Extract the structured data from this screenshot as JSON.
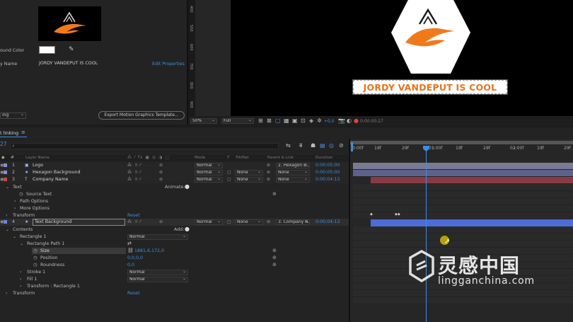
{
  "essential_graphics": {
    "background_color_label": "ound Color",
    "name_label": "y Name",
    "name_value": "JORDY VANDEPUT IS COOL",
    "edit_properties": "Edit Properties",
    "bottom_left_dropdown": "ing",
    "export_button": "Export Motion Graphics Template..."
  },
  "ruler_labels": [
    "400",
    "500",
    "600",
    "700",
    "800",
    "900"
  ],
  "viewer": {
    "title_text": "JORDY VANDEPUT IS COOL",
    "zoom": "50%",
    "quality": "Full",
    "exposure": "+0,0",
    "timecode": "0:00:00:27",
    "colors": {
      "logo_orange": "#f07a1a",
      "text_orange": "#e8731b",
      "hex_white": "#ffffff"
    }
  },
  "timeline": {
    "panel_title": "t linking",
    "current_time": "27",
    "search_placeholder": "",
    "headers": {
      "layer_name": "Layer Name",
      "mode": "Mode",
      "t": "T",
      "trkmat": "TrkMat",
      "parent": "Parent & Link",
      "duration": "Duration"
    },
    "ruler": [
      "0:00f",
      "10f",
      "20f",
      "01:00f",
      "10f",
      "20f",
      "02:00f",
      "10f",
      "20f"
    ],
    "layers": [
      {
        "num": "1",
        "name": "Logo",
        "mode": "Normal",
        "trkmat": "",
        "parent": "2. Hexagon B...",
        "duration": "0:00:05:00"
      },
      {
        "num": "2",
        "name": "Hexagon Background",
        "mode": "Normal",
        "trkmat": "None",
        "parent": "None",
        "duration": "0:00:05:00"
      },
      {
        "num": "3",
        "name": "Company Name",
        "mode": "Normal",
        "trkmat": "None",
        "parent": "None",
        "duration": "0:00:04:13"
      },
      {
        "num": "4",
        "name": "Text Background",
        "mode": "Normal",
        "trkmat": "None",
        "parent": "3. Company N...",
        "duration": "0:00:04:13"
      }
    ],
    "text_group": {
      "text": "Text",
      "source_text": "Source Text",
      "path_options": "Path Options",
      "more_options": "More Options",
      "transform": "Transform",
      "animate": "Animate:",
      "reset": "Reset"
    },
    "contents_group": {
      "contents": "Contents",
      "add": "Add:",
      "rectangle": "Rectangle 1",
      "rectangle_mode": "Normal",
      "rect_path": "Rectangle Path 1",
      "size_label": "Size",
      "size_value": "1881,6,172,0",
      "position_label": "Position",
      "position_value": "0,0,0,0",
      "roundness_label": "Roundness",
      "roundness_value": "0,0",
      "stroke": "Stroke 1",
      "stroke_mode": "Normal",
      "fill": "Fill 1",
      "fill_mode": "Normal",
      "transform_rect": "Transform : Rectangle 1",
      "transform": "Transform",
      "reset": "Reset"
    }
  },
  "watermark": {
    "cn": "灵感中国",
    "url": "lingganchina.com"
  }
}
